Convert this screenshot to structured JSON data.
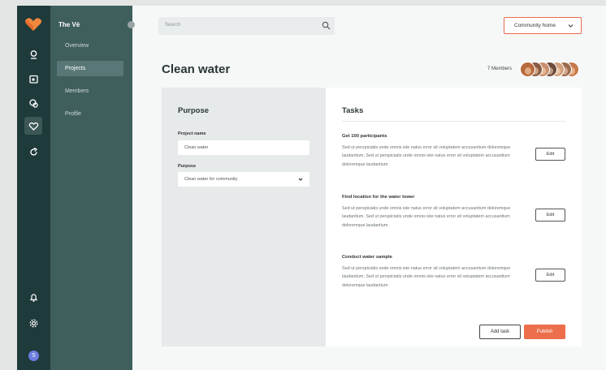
{
  "nav": {
    "brand": "The Vé",
    "items": [
      {
        "label": "Overview"
      },
      {
        "label": "Projects",
        "active": true
      },
      {
        "label": "Members"
      },
      {
        "label": "Profile"
      }
    ]
  },
  "rail": {
    "icons": [
      "heart-logo-icon",
      "location-icon",
      "calendar-icon",
      "chat-icon",
      "heart-icon",
      "refresh-icon",
      "bell-icon",
      "settings-icon"
    ],
    "user_initial": "S"
  },
  "search": {
    "placeholder": "Search"
  },
  "community_select": {
    "label": "Community home"
  },
  "page": {
    "title": "Clean water",
    "members": "7 Members",
    "avatar_colors": [
      "#b86a3c",
      "#8a5a44",
      "#c98f6e",
      "#6e4a3a",
      "#d2a07e",
      "#9c6b50",
      "#c7794a"
    ]
  },
  "purpose": {
    "heading": "Purpose",
    "project_name_label": "Project name",
    "project_name_value": "Clean water",
    "purpose_label": "Purpose",
    "purpose_value": "Clean water for community"
  },
  "tasks": {
    "heading": "Tasks",
    "edit_label": "Edit",
    "items": [
      {
        "title": "Get 100 participants",
        "body": "Sed ut perspiciatis unde omnis iste natus error sit voluptatem accusantium doloremque laudantium. Sed ut perspiciatis unde omnis iste natus error sit voluptatem accusantium doloremque laudantium."
      },
      {
        "title": "Find location for the water tower",
        "body": "Sed ut perspiciatis unde omnis iste natus error sit voluptatem accusantium doloremque laudantium. Sed ut perspiciatis unde omnis iste natus error sit voluptatem accusantium doloremque laudantium."
      },
      {
        "title": "Conduct water sample",
        "body": "Sed ut perspiciatis unde omnis iste natus error sit voluptatem accusantium doloremque laudantium. Sed ut perspiciatis unde omnis iste natus error sit voluptatem accusantium doloremque laudantium."
      }
    ],
    "add_label": "Add task",
    "publish_label": "Publish"
  },
  "colors": {
    "accent": "#ec6e4a",
    "rail": "#1f3a3a",
    "nav": "#3f5f5d"
  }
}
